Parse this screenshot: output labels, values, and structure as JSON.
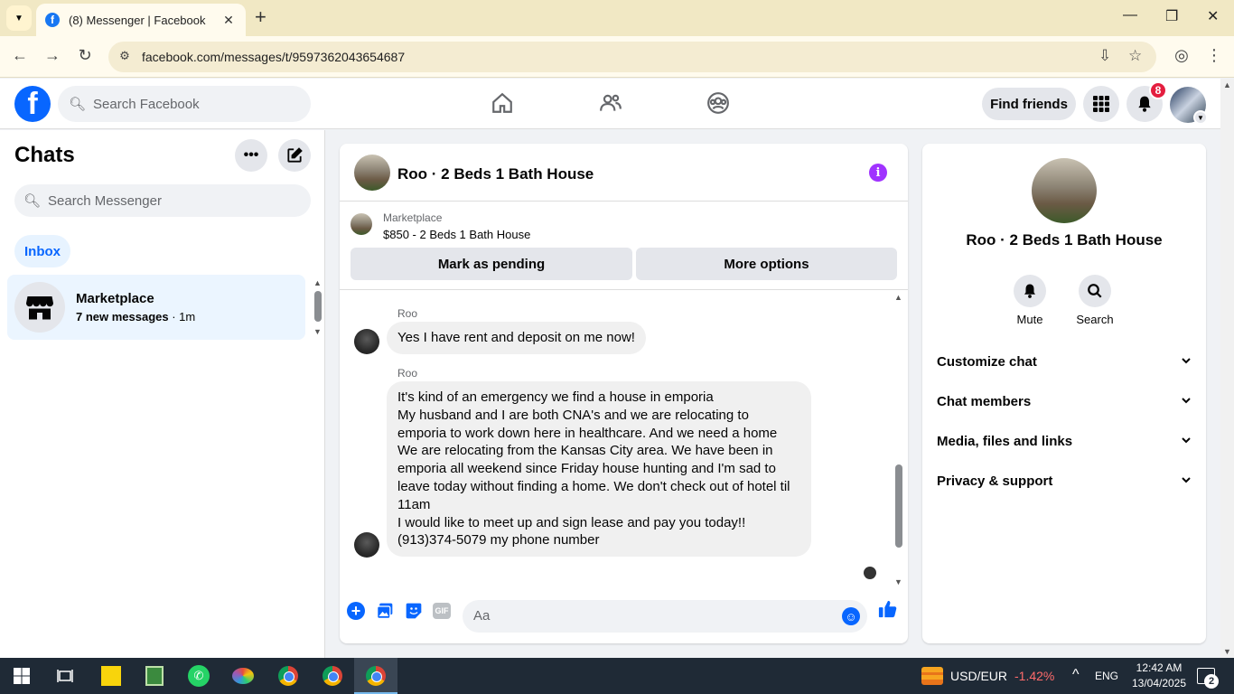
{
  "browser": {
    "tab_title": "(8) Messenger | Facebook",
    "url": "facebook.com/messages/t/9597362043654687"
  },
  "fb_header": {
    "search_placeholder": "Search Facebook",
    "find_friends_label": "Find friends",
    "notification_count": "8"
  },
  "chats": {
    "title": "Chats",
    "search_placeholder": "Search Messenger",
    "inbox_label": "Inbox",
    "items": [
      {
        "name": "Marketplace",
        "preview": "7 new messages",
        "time": " · 1m"
      }
    ]
  },
  "conversation": {
    "title": "Roo · 2 Beds 1 Bath House",
    "marketplace_label": "Marketplace",
    "listing": "$850 - 2 Beds 1 Bath House",
    "mark_pending_label": "Mark as pending",
    "more_options_label": "More options",
    "messages": [
      {
        "sender": "Roo",
        "text": "Yes I have rent and deposit on me now!"
      },
      {
        "sender": "Roo",
        "lines": [
          "It's kind of an emergency we find a house in emporia",
          "My husband and I are both CNA's and we are relocating to",
          "emporia to work down here in healthcare. And we need a home",
          "We are relocating from the Kansas City area. We have been in",
          "emporia all weekend since Friday house hunting and I'm sad to",
          "leave today without finding a home. We don't check out of hotel til",
          "11am",
          "I would like to meet up and sign lease and pay you today!!",
          "(913)374-5079 my phone number"
        ]
      }
    ],
    "composer_placeholder": "Aa",
    "gif_label": "GIF"
  },
  "info_panel": {
    "name": "Roo · 2 Beds 1 Bath House",
    "actions": [
      {
        "label": "Mute"
      },
      {
        "label": "Search"
      }
    ],
    "sections": [
      {
        "label": "Customize chat"
      },
      {
        "label": "Chat members"
      },
      {
        "label": "Media, files and links"
      },
      {
        "label": "Privacy & support"
      }
    ]
  },
  "taskbar": {
    "ticker_pair": "USD/EUR",
    "ticker_change": "-1.42%",
    "language": "ENG",
    "time": "12:42 AM",
    "date": "13/04/2025",
    "notification_count": "2"
  },
  "colors": {
    "fb_blue": "#0866ff",
    "badge_red": "#e41e3f",
    "info_purple": "#a033ff",
    "taskbar_bg": "#1f2a36"
  }
}
